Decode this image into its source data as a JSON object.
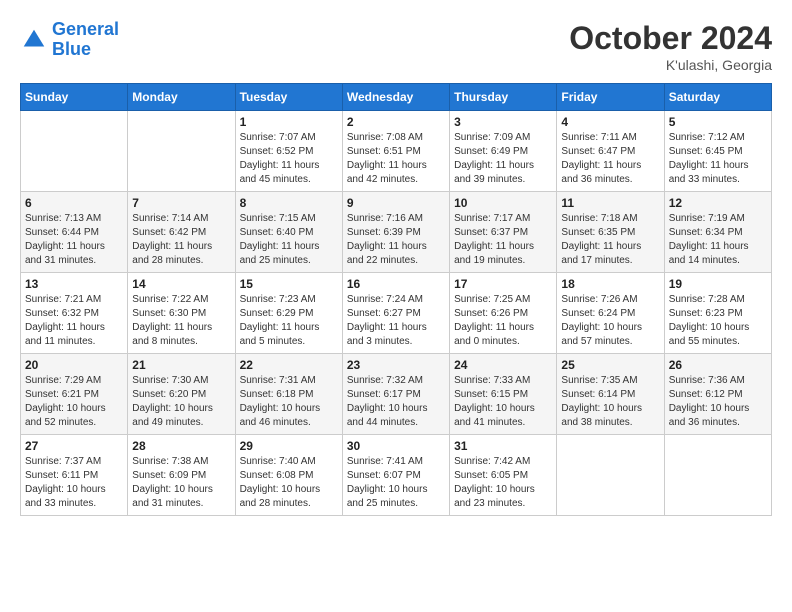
{
  "header": {
    "logo_line1": "General",
    "logo_line2": "Blue",
    "month_title": "October 2024",
    "location": "K'ulashi, Georgia"
  },
  "days_of_week": [
    "Sunday",
    "Monday",
    "Tuesday",
    "Wednesday",
    "Thursday",
    "Friday",
    "Saturday"
  ],
  "weeks": [
    [
      {
        "day": "",
        "sunrise": "",
        "sunset": "",
        "daylight": ""
      },
      {
        "day": "",
        "sunrise": "",
        "sunset": "",
        "daylight": ""
      },
      {
        "day": "1",
        "sunrise": "Sunrise: 7:07 AM",
        "sunset": "Sunset: 6:52 PM",
        "daylight": "Daylight: 11 hours and 45 minutes."
      },
      {
        "day": "2",
        "sunrise": "Sunrise: 7:08 AM",
        "sunset": "Sunset: 6:51 PM",
        "daylight": "Daylight: 11 hours and 42 minutes."
      },
      {
        "day": "3",
        "sunrise": "Sunrise: 7:09 AM",
        "sunset": "Sunset: 6:49 PM",
        "daylight": "Daylight: 11 hours and 39 minutes."
      },
      {
        "day": "4",
        "sunrise": "Sunrise: 7:11 AM",
        "sunset": "Sunset: 6:47 PM",
        "daylight": "Daylight: 11 hours and 36 minutes."
      },
      {
        "day": "5",
        "sunrise": "Sunrise: 7:12 AM",
        "sunset": "Sunset: 6:45 PM",
        "daylight": "Daylight: 11 hours and 33 minutes."
      }
    ],
    [
      {
        "day": "6",
        "sunrise": "Sunrise: 7:13 AM",
        "sunset": "Sunset: 6:44 PM",
        "daylight": "Daylight: 11 hours and 31 minutes."
      },
      {
        "day": "7",
        "sunrise": "Sunrise: 7:14 AM",
        "sunset": "Sunset: 6:42 PM",
        "daylight": "Daylight: 11 hours and 28 minutes."
      },
      {
        "day": "8",
        "sunrise": "Sunrise: 7:15 AM",
        "sunset": "Sunset: 6:40 PM",
        "daylight": "Daylight: 11 hours and 25 minutes."
      },
      {
        "day": "9",
        "sunrise": "Sunrise: 7:16 AM",
        "sunset": "Sunset: 6:39 PM",
        "daylight": "Daylight: 11 hours and 22 minutes."
      },
      {
        "day": "10",
        "sunrise": "Sunrise: 7:17 AM",
        "sunset": "Sunset: 6:37 PM",
        "daylight": "Daylight: 11 hours and 19 minutes."
      },
      {
        "day": "11",
        "sunrise": "Sunrise: 7:18 AM",
        "sunset": "Sunset: 6:35 PM",
        "daylight": "Daylight: 11 hours and 17 minutes."
      },
      {
        "day": "12",
        "sunrise": "Sunrise: 7:19 AM",
        "sunset": "Sunset: 6:34 PM",
        "daylight": "Daylight: 11 hours and 14 minutes."
      }
    ],
    [
      {
        "day": "13",
        "sunrise": "Sunrise: 7:21 AM",
        "sunset": "Sunset: 6:32 PM",
        "daylight": "Daylight: 11 hours and 11 minutes."
      },
      {
        "day": "14",
        "sunrise": "Sunrise: 7:22 AM",
        "sunset": "Sunset: 6:30 PM",
        "daylight": "Daylight: 11 hours and 8 minutes."
      },
      {
        "day": "15",
        "sunrise": "Sunrise: 7:23 AM",
        "sunset": "Sunset: 6:29 PM",
        "daylight": "Daylight: 11 hours and 5 minutes."
      },
      {
        "day": "16",
        "sunrise": "Sunrise: 7:24 AM",
        "sunset": "Sunset: 6:27 PM",
        "daylight": "Daylight: 11 hours and 3 minutes."
      },
      {
        "day": "17",
        "sunrise": "Sunrise: 7:25 AM",
        "sunset": "Sunset: 6:26 PM",
        "daylight": "Daylight: 11 hours and 0 minutes."
      },
      {
        "day": "18",
        "sunrise": "Sunrise: 7:26 AM",
        "sunset": "Sunset: 6:24 PM",
        "daylight": "Daylight: 10 hours and 57 minutes."
      },
      {
        "day": "19",
        "sunrise": "Sunrise: 7:28 AM",
        "sunset": "Sunset: 6:23 PM",
        "daylight": "Daylight: 10 hours and 55 minutes."
      }
    ],
    [
      {
        "day": "20",
        "sunrise": "Sunrise: 7:29 AM",
        "sunset": "Sunset: 6:21 PM",
        "daylight": "Daylight: 10 hours and 52 minutes."
      },
      {
        "day": "21",
        "sunrise": "Sunrise: 7:30 AM",
        "sunset": "Sunset: 6:20 PM",
        "daylight": "Daylight: 10 hours and 49 minutes."
      },
      {
        "day": "22",
        "sunrise": "Sunrise: 7:31 AM",
        "sunset": "Sunset: 6:18 PM",
        "daylight": "Daylight: 10 hours and 46 minutes."
      },
      {
        "day": "23",
        "sunrise": "Sunrise: 7:32 AM",
        "sunset": "Sunset: 6:17 PM",
        "daylight": "Daylight: 10 hours and 44 minutes."
      },
      {
        "day": "24",
        "sunrise": "Sunrise: 7:33 AM",
        "sunset": "Sunset: 6:15 PM",
        "daylight": "Daylight: 10 hours and 41 minutes."
      },
      {
        "day": "25",
        "sunrise": "Sunrise: 7:35 AM",
        "sunset": "Sunset: 6:14 PM",
        "daylight": "Daylight: 10 hours and 38 minutes."
      },
      {
        "day": "26",
        "sunrise": "Sunrise: 7:36 AM",
        "sunset": "Sunset: 6:12 PM",
        "daylight": "Daylight: 10 hours and 36 minutes."
      }
    ],
    [
      {
        "day": "27",
        "sunrise": "Sunrise: 7:37 AM",
        "sunset": "Sunset: 6:11 PM",
        "daylight": "Daylight: 10 hours and 33 minutes."
      },
      {
        "day": "28",
        "sunrise": "Sunrise: 7:38 AM",
        "sunset": "Sunset: 6:09 PM",
        "daylight": "Daylight: 10 hours and 31 minutes."
      },
      {
        "day": "29",
        "sunrise": "Sunrise: 7:40 AM",
        "sunset": "Sunset: 6:08 PM",
        "daylight": "Daylight: 10 hours and 28 minutes."
      },
      {
        "day": "30",
        "sunrise": "Sunrise: 7:41 AM",
        "sunset": "Sunset: 6:07 PM",
        "daylight": "Daylight: 10 hours and 25 minutes."
      },
      {
        "day": "31",
        "sunrise": "Sunrise: 7:42 AM",
        "sunset": "Sunset: 6:05 PM",
        "daylight": "Daylight: 10 hours and 23 minutes."
      },
      {
        "day": "",
        "sunrise": "",
        "sunset": "",
        "daylight": ""
      },
      {
        "day": "",
        "sunrise": "",
        "sunset": "",
        "daylight": ""
      }
    ]
  ]
}
